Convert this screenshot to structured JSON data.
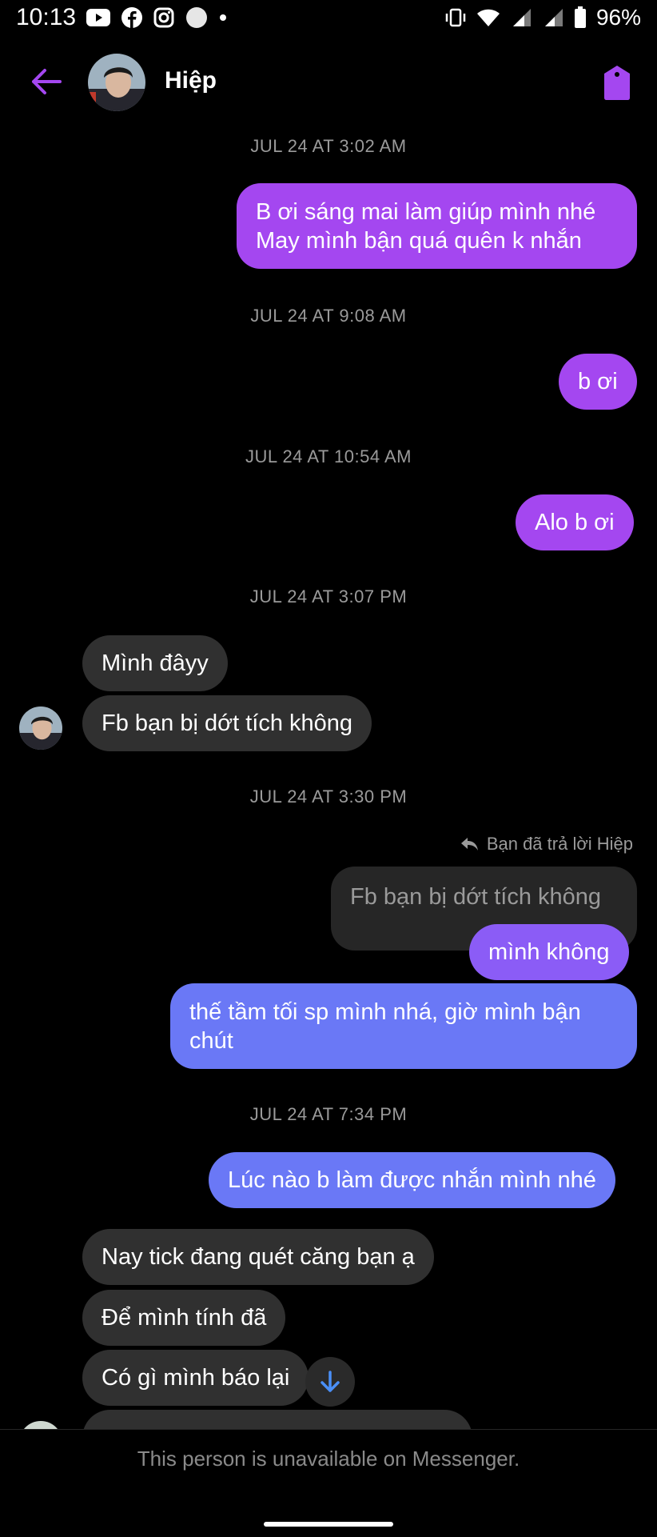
{
  "status_bar": {
    "time": "10:13",
    "battery": "96%",
    "left_icons": [
      "youtube-icon",
      "facebook-icon",
      "instagram-icon",
      "circle-icon",
      "dot-icon"
    ],
    "right_icons": [
      "vibrate-icon",
      "wifi-icon",
      "signal-icon",
      "signal-icon",
      "battery-icon"
    ]
  },
  "header": {
    "contact_name": "Hiệp",
    "back_icon": "back-arrow-icon",
    "action_icon": "tag-icon",
    "accent_color": "#a447f0"
  },
  "conversation": {
    "timestamps": [
      "JUL 24 AT 3:02 AM",
      "JUL 24 AT 9:08 AM",
      "JUL 24 AT 10:54 AM",
      "JUL 24 AT 3:07 PM",
      "JUL 24 AT 3:30 PM",
      "JUL 24 AT 7:34 PM"
    ],
    "messages": [
      {
        "sender": "me",
        "line1": "B ơi sáng mai làm giúp mình nhé",
        "line2": "May mình bận quá quên k nhắn"
      },
      {
        "sender": "me",
        "text": "b ơi"
      },
      {
        "sender": "me",
        "text": "Alo b ơi"
      },
      {
        "sender": "them",
        "text": "Mình đâyy"
      },
      {
        "sender": "them",
        "text": "Fb bạn bị dớt tích không"
      },
      {
        "sender": "me",
        "reply_note": "Bạn đã trả lời Hiệp",
        "quoted": "Fb bạn bị dớt tích không",
        "text": "mình không"
      },
      {
        "sender": "me",
        "line1": "thế tầm tối sp mình nhá, giờ mình bận",
        "line2": "chút"
      },
      {
        "sender": "me",
        "text": "Lúc nào b làm được nhắn mình nhé"
      },
      {
        "sender": "them",
        "text": "Nay tick đang quét căng bạn ạ"
      },
      {
        "sender": "them",
        "text": "Để mình tính đã"
      },
      {
        "sender": "them",
        "text": "Có gì mình báo lại"
      }
    ],
    "colors": {
      "me_purple": "#a447f0",
      "me_mid": "#8b5cf6",
      "me_blue": "#6a78f6",
      "them_grey": "#303030"
    }
  },
  "footer": {
    "unavailable_text": "This person is unavailable on Messenger.",
    "scroll_icon": "arrow-down-icon"
  }
}
